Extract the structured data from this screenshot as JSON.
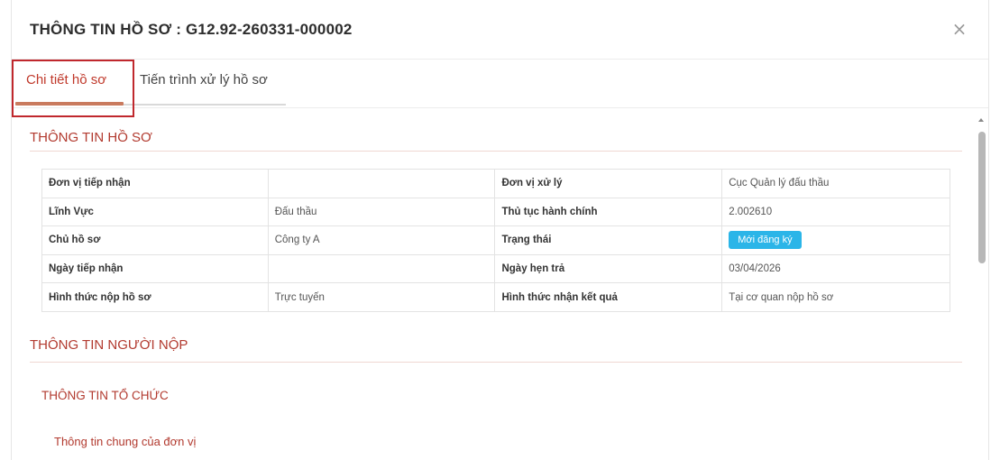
{
  "modal": {
    "title": "THÔNG TIN HỒ SƠ : G12.92-260331-000002",
    "close_glyph": "×"
  },
  "tabs": [
    {
      "label": "Chi tiết hồ sơ",
      "active": true
    },
    {
      "label": "Tiến trình xử lý hồ sơ",
      "active": false
    }
  ],
  "sections": {
    "record_info": "THÔNG TIN HỒ SƠ",
    "submitter_info": "THÔNG TIN NGƯỜI NỘP",
    "organization_info": "THÔNG TIN TỔ CHỨC",
    "general_info": "Thông tin chung của đơn vị"
  },
  "table": {
    "rows": [
      {
        "label_left": "Đơn vị tiếp nhận",
        "value_left": "",
        "label_right": "Đơn vị xử lý",
        "value_right": "Cục Quản lý đấu thầu"
      },
      {
        "label_left": "Lĩnh Vực",
        "value_left": "Đấu thầu",
        "label_right": "Thủ tục hành chính",
        "value_right": "2.002610"
      },
      {
        "label_left": "Chủ hồ sơ",
        "value_left": "Công ty A",
        "label_right": "Trạng thái",
        "value_right": "Mới đăng ký"
      },
      {
        "label_left": "Ngày tiếp nhận",
        "value_left": "",
        "label_right": "Ngày hẹn trả",
        "value_right": "03/04/2026"
      },
      {
        "label_left": "Hình thức nộp hồ sơ",
        "value_left": "Trực tuyến",
        "label_right": "Hình thức nhận kết quả",
        "value_right": "Tại cơ quan nộp hồ sơ"
      }
    ]
  },
  "colors": {
    "accent": "#c97a5e",
    "section_title": "#b23a2f",
    "status_badge": "#2bb5e8",
    "highlight_box": "#c0282d"
  }
}
